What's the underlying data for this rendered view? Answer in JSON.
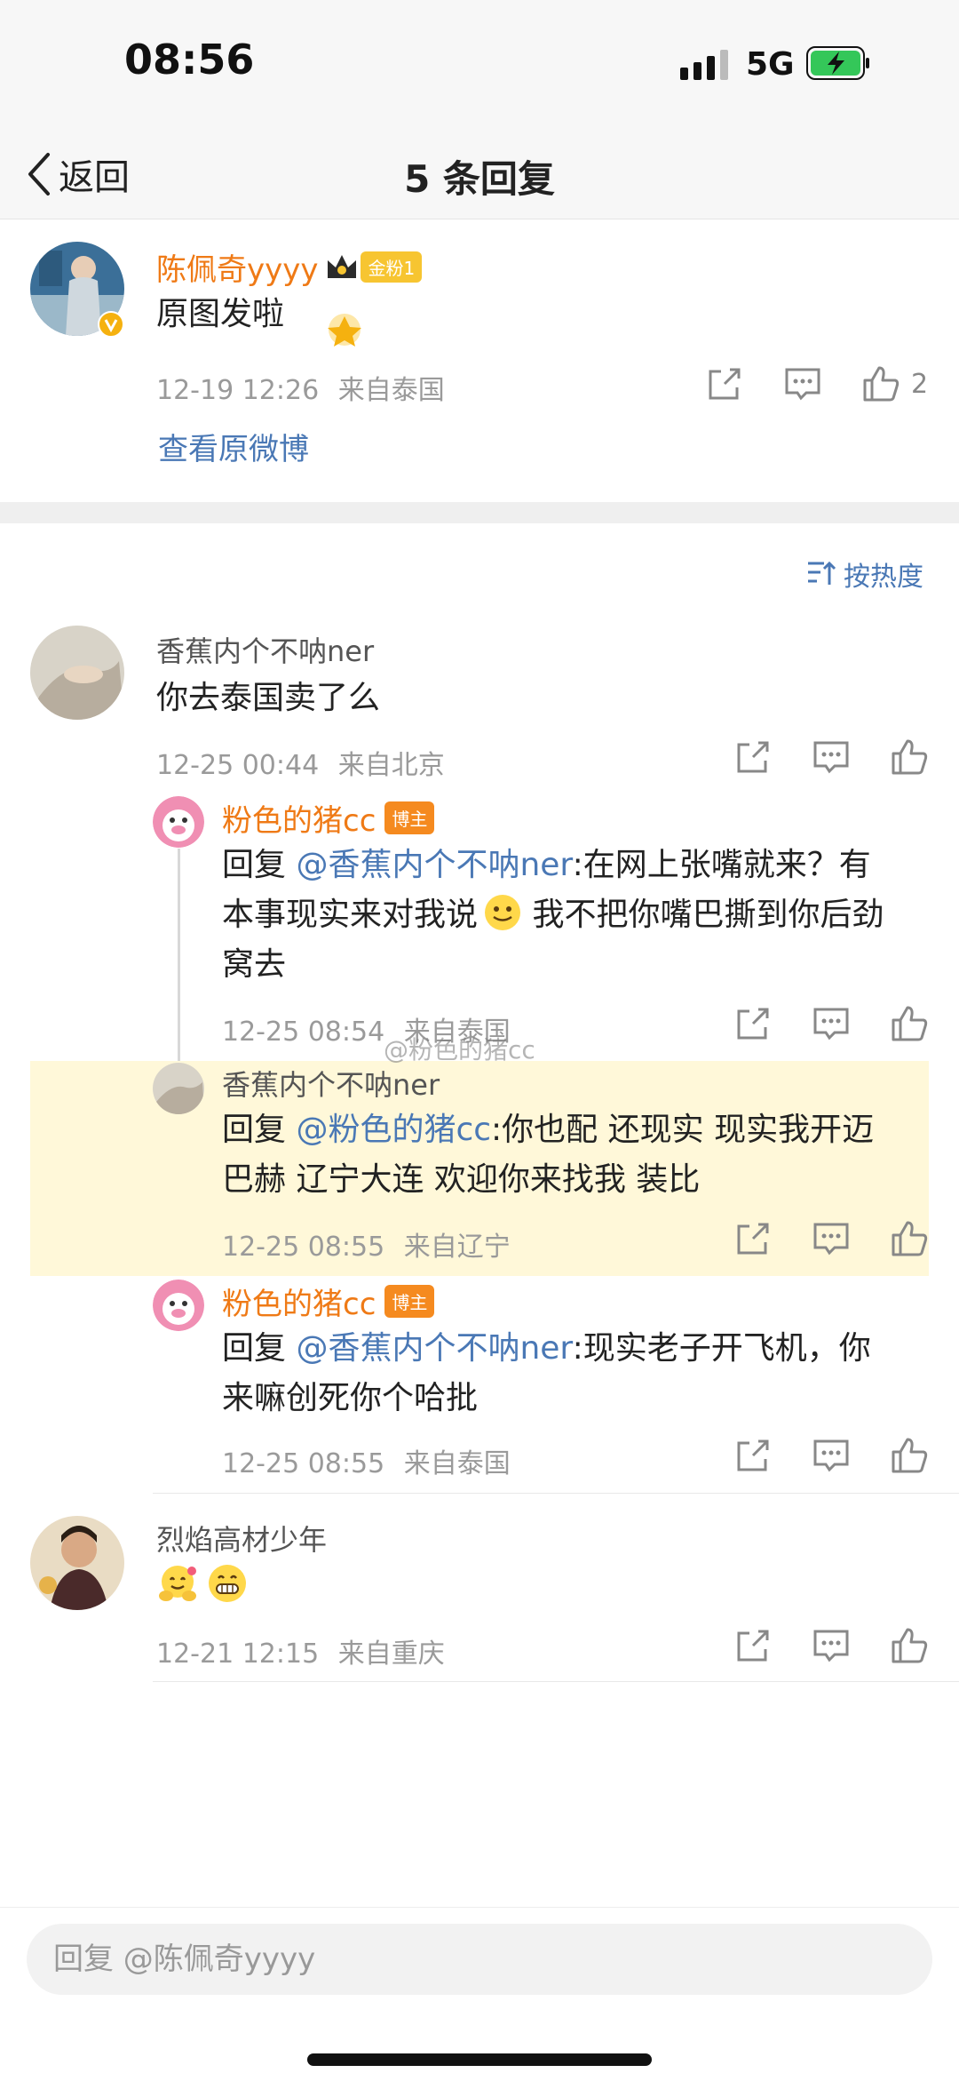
{
  "status_bar": {
    "time": "08:56",
    "network": "5G"
  },
  "nav": {
    "back_label": "返回",
    "title": "5 条回复"
  },
  "main_comment": {
    "username": "陈佩奇yyyy",
    "fan_badge": "金粉1",
    "text": "原图发啦",
    "time": "12-19 12:26",
    "location": "来自泰国",
    "likes": "2",
    "view_original": "查看原微博"
  },
  "sort": {
    "label": "按热度"
  },
  "comments": [
    {
      "username": "香蕉内个不呐ner",
      "text": "你去泰国卖了么",
      "time": "12-25 00:44",
      "location": "来自北京",
      "replies": [
        {
          "username": "粉色的猪cc",
          "badge": "博主",
          "reply_prefix": "回复 ",
          "mention": "@香蕉内个不呐ner",
          "text_line1": ":在网上张嘴就来？有",
          "text_line2": "本事现实来对我说",
          "text_line2b": " 我不把你嘴巴撕到你后劲",
          "text_line3": "窝去",
          "time": "12-25 08:54",
          "location": "来自泰国"
        },
        {
          "username": "香蕉内个不呐ner",
          "reply_prefix": "回复 ",
          "mention": "@粉色的猪cc",
          "text_line1": ":你也配 还现实 现实我开迈",
          "text_line2": "巴赫 辽宁大连 欢迎你来找我 装比",
          "time": "12-25 08:55",
          "location": "来自辽宁"
        },
        {
          "username": "粉色的猪cc",
          "badge": "博主",
          "reply_prefix": "回复 ",
          "mention": "@香蕉内个不呐ner",
          "text_line1": ":现实老子开飞机，你",
          "text_line2": "来嘛创死你个哈批",
          "time": "12-25 08:55",
          "location": "来自泰国"
        }
      ]
    },
    {
      "username": "烈焰高材少年",
      "text": "",
      "time": "12-21 12:15",
      "location": "来自重庆"
    }
  ],
  "watermark": "@粉色的猪cc",
  "reply_bar": {
    "placeholder": "回复 @陈佩奇yyyy"
  },
  "colors": {
    "accent_orange": "#ef7a16",
    "link_blue": "#4a78b5",
    "highlight": "#fff8d9"
  },
  "icons": [
    "signal-icon",
    "battery-charging-icon",
    "chevron-left-icon",
    "share-icon",
    "comment-icon",
    "like-icon",
    "sort-icon",
    "crown-icon",
    "verified-icon",
    "smile-emoji",
    "hug-emoji",
    "grin-emoji"
  ]
}
